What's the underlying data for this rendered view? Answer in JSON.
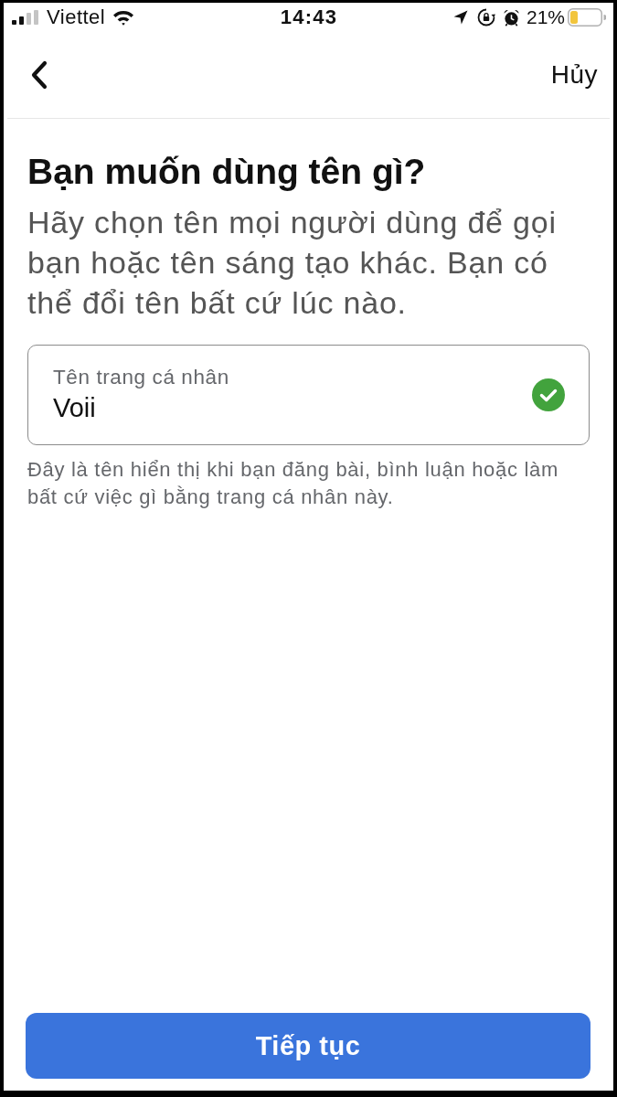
{
  "status_bar": {
    "carrier": "Viettel",
    "time": "14:43",
    "battery_percent": "21%"
  },
  "nav": {
    "cancel": "Hủy"
  },
  "heading": "Bạn muốn dùng tên gì?",
  "description": "Hãy chọn tên mọi người dùng để gọi bạn hoặc tên sáng tạo khác. Bạn có thể đổi tên bất cứ lúc nào.",
  "name_field": {
    "label": "Tên trang cá nhân",
    "value": "Voii",
    "valid": true
  },
  "helper_text": "Đây là tên hiển thị khi bạn đăng bài, bình luận hoặc làm bất cứ việc gì bằng trang cá nhân này.",
  "primary_button": {
    "label": "Tiếp tục"
  }
}
